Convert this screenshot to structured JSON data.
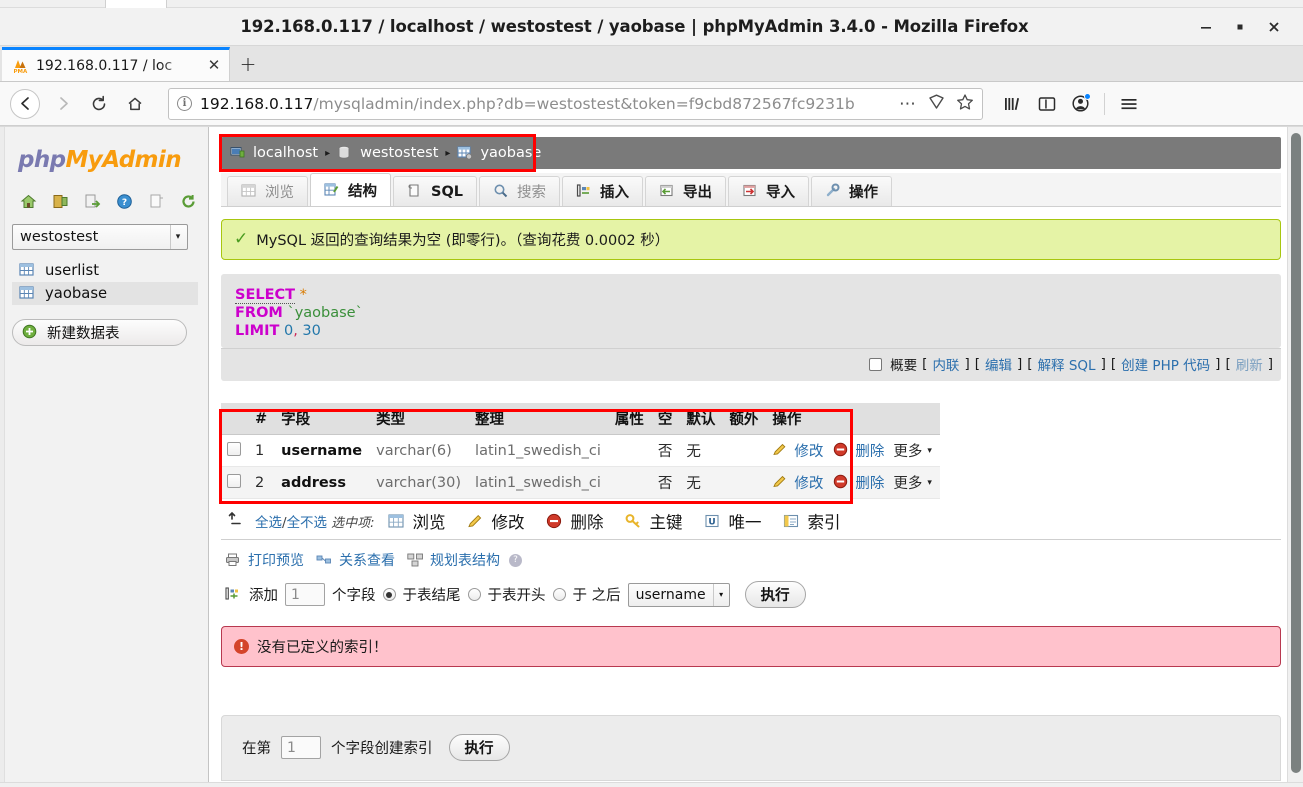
{
  "window": {
    "title": "192.168.0.117 / localhost / westostest / yaobase | phpMyAdmin 3.4.0 - Mozilla Firefox",
    "minimize_label": "–",
    "maximize_label": "▫",
    "close_label": "✕"
  },
  "browser": {
    "tab": {
      "title": "192.168.0.117 / loc",
      "favicon": "phpmyadmin-favicon",
      "close_label": "✕"
    },
    "newtab_label": "+",
    "nav": {
      "back": "←",
      "forward": "→",
      "reload": "⟳",
      "home": "⌂"
    },
    "url": {
      "host": "192.168.0.117",
      "path": "/mysqladmin/index.php?db=westostest&token=f9cbd872567fc9231b",
      "security_icon": "info-icon",
      "page_actions_label": "⋯",
      "reader_icon": "reader-mode-icon",
      "bookmark_icon": "star-icon"
    },
    "toolbar": {
      "library_icon": "library-icon",
      "sidebar_icon": "sidebar-icon",
      "account_icon": "account-icon",
      "menu_icon": "hamburger-menu-icon"
    }
  },
  "sidebar": {
    "logo_php": "php",
    "logo_myadmin": "MyAdmin",
    "icons": [
      {
        "name": "home-icon"
      },
      {
        "name": "logout-icon"
      },
      {
        "name": "export-icon"
      },
      {
        "name": "help-icon"
      },
      {
        "name": "docs-icon"
      },
      {
        "name": "reload-icon"
      }
    ],
    "db_select": {
      "value": "westostest",
      "arrow": "▾"
    },
    "tables": [
      {
        "label": "userlist",
        "selected": false
      },
      {
        "label": "yaobase",
        "selected": true
      }
    ],
    "new_table_button": "新建数据表"
  },
  "breadcrumb": {
    "server": "localhost",
    "database": "westostest",
    "table": "yaobase",
    "separator": "▸"
  },
  "tabs": [
    {
      "label": "浏览",
      "icon": "browse-icon",
      "active": false,
      "dim": true
    },
    {
      "label": "结构",
      "icon": "structure-icon",
      "active": true,
      "dim": false
    },
    {
      "label": "SQL",
      "icon": "sql-icon",
      "active": false,
      "dim": false
    },
    {
      "label": "搜索",
      "icon": "search-icon",
      "active": false,
      "dim": true
    },
    {
      "label": "插入",
      "icon": "insert-icon",
      "active": false,
      "dim": false
    },
    {
      "label": "导出",
      "icon": "export-icon",
      "active": false,
      "dim": false
    },
    {
      "label": "导入",
      "icon": "import-icon",
      "active": false,
      "dim": false
    },
    {
      "label": "操作",
      "icon": "operations-icon",
      "active": false,
      "dim": false
    }
  ],
  "notice": {
    "icon": "success-check-icon",
    "text": "MySQL 返回的查询结果为空 (即零行)。（查询花费 0.0002 秒）"
  },
  "sql": {
    "line1_kw": "SELECT",
    "line1_star": "*",
    "line2_kw": "FROM",
    "line2_tbl": "`yaobase`",
    "line3_kw": "LIMIT",
    "line3_a": "0",
    "line3_comma": ",",
    "line3_b": "30",
    "footer": {
      "summary": "概要",
      "open_b1": "[",
      "inline": "内联",
      "close_b1": "]",
      "open_b2": "[",
      "edit": "编辑",
      "close_b2": "]",
      "open_b3": "[",
      "explain": "解释 SQL",
      "close_b3": "]",
      "open_b4": "[",
      "create_php": "创建 PHP 代码",
      "close_b4": "]",
      "open_b5": "[",
      "refresh": "刷新",
      "close_b5": "]"
    }
  },
  "structure": {
    "headers": [
      "#",
      "字段",
      "类型",
      "整理",
      "属性",
      "空",
      "默认",
      "额外",
      "操作"
    ],
    "rows": [
      {
        "num": "1",
        "field": "username",
        "type": "varchar(6)",
        "collation": "latin1_swedish_ci",
        "attributes": "",
        "nullable": "否",
        "default": "无",
        "extra": "",
        "edit": "修改",
        "drop": "删除",
        "more": "更多",
        "more_caret": "▾"
      },
      {
        "num": "2",
        "field": "address",
        "type": "varchar(30)",
        "collation": "latin1_swedish_ci",
        "attributes": "",
        "nullable": "否",
        "default": "无",
        "extra": "",
        "edit": "修改",
        "drop": "删除",
        "more": "更多",
        "more_caret": "▾"
      }
    ]
  },
  "actionbar": {
    "arrow": "↑",
    "select_all": "全选",
    "slash": "/",
    "select_none": "全不选",
    "with_selected": "选中项:",
    "actions": [
      {
        "label": "浏览",
        "icon": "browse-icon"
      },
      {
        "label": "修改",
        "icon": "edit-pencil-icon"
      },
      {
        "label": "删除",
        "icon": "delete-icon"
      },
      {
        "label": "主键",
        "icon": "primary-key-icon"
      },
      {
        "label": "唯一",
        "icon": "unique-icon"
      },
      {
        "label": "索引",
        "icon": "index-icon"
      }
    ]
  },
  "meta_links": [
    {
      "label": "打印预览",
      "icon": "printer-icon"
    },
    {
      "label": "关系查看",
      "icon": "relation-icon"
    },
    {
      "label": "规划表结构",
      "icon": "designer-icon"
    }
  ],
  "meta_help_icon": "help-question-icon",
  "add_field_form": {
    "icon": "add-field-icon",
    "add_label": "添加",
    "count_value": "1",
    "fields_label": "个字段",
    "option_end": "于表结尾",
    "option_beginning": "于表开头",
    "option_after": "于 之后",
    "selected_option": "end",
    "after_field_value": "username",
    "after_field_arrow": "▾",
    "go_label": "执行"
  },
  "error": {
    "icon": "warning-icon",
    "text": "没有已定义的索引！"
  },
  "index_form": {
    "prefix": "在第",
    "count_value": "1",
    "suffix": "个字段创建索引",
    "go_label": "执行"
  },
  "colors": {
    "highlight_red": "#ff0000",
    "breadcrumb_bg": "#7a7a7a",
    "notice_bg": "#e5f3a6",
    "error_bg": "#ffc2cc",
    "link_blue": "#2b6fad",
    "pma_orange": "#f89c0e",
    "pma_purple": "#7a7ab0"
  }
}
